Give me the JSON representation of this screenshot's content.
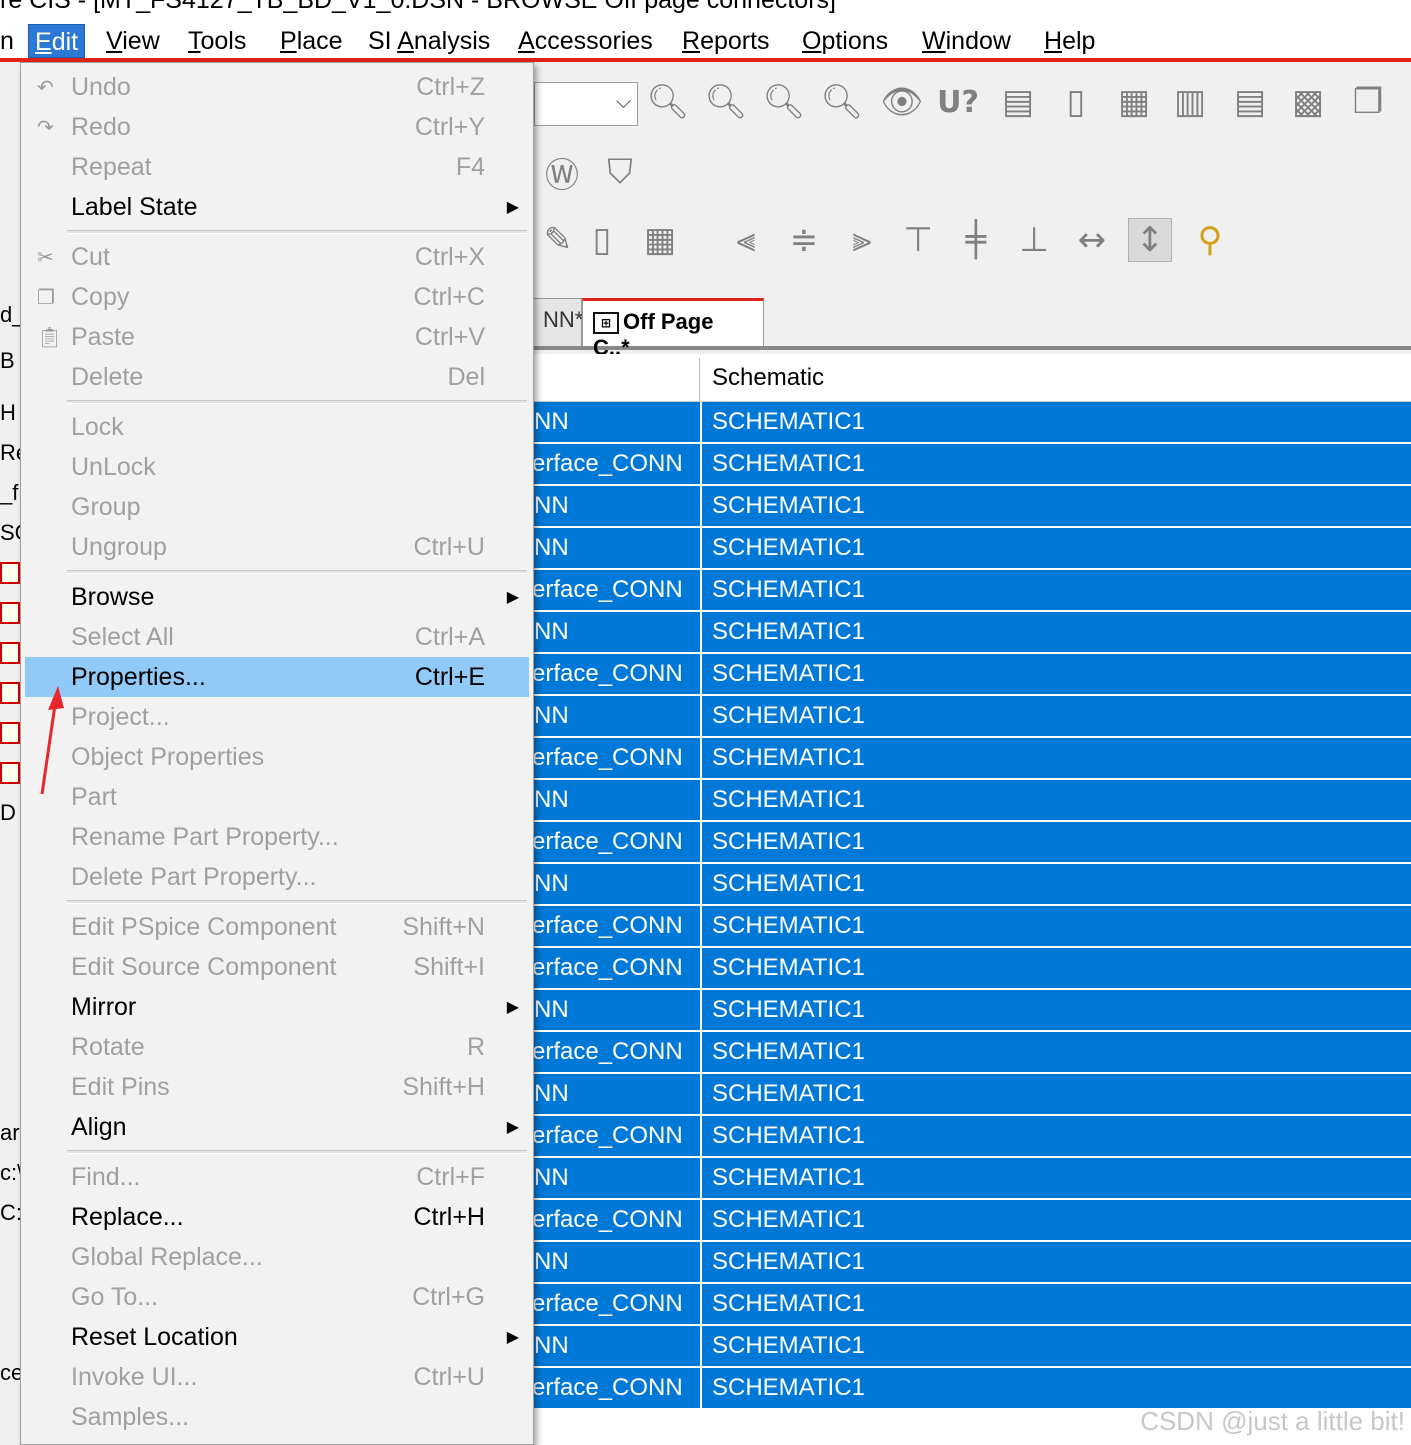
{
  "window": {
    "title": "re CIS - [MT_FS4127_TB_BD_V1_0.DSN - BROWSE Off page connectors]"
  },
  "menubar": {
    "items": [
      {
        "label": "n",
        "id": "file-fragment"
      },
      {
        "label": "Edit",
        "u": "E",
        "active": true
      },
      {
        "label": "View",
        "u": "V"
      },
      {
        "label": "Tools",
        "u": "T"
      },
      {
        "label": "Place",
        "u": "P"
      },
      {
        "label": "SI Analysis",
        "u": "A"
      },
      {
        "label": "Accessories",
        "u": "A"
      },
      {
        "label": "Reports",
        "u": "R"
      },
      {
        "label": "Options",
        "u": "O"
      },
      {
        "label": "Window",
        "u": "W"
      },
      {
        "label": "Help",
        "u": "H"
      }
    ]
  },
  "toolbar": {
    "row1_icons": [
      "zoom-in-icon",
      "zoom-out-icon",
      "zoom-area-icon",
      "zoom-all-icon",
      "eye-icon",
      "u-icon",
      "export-icon",
      "page-icon",
      "netlist-icon",
      "bom-icon",
      "report-icon",
      "grid-icon",
      "copy-page-icon"
    ],
    "row3_icons": [
      "align-left-icon",
      "align-center-icon",
      "align-right-icon",
      "align-top-icon",
      "align-middle-icon",
      "align-bottom-icon",
      "distribute-horizontal-icon",
      "distribute-vertical-icon",
      "tag-icon"
    ]
  },
  "tabs": {
    "inactive_label": "NN*",
    "active_label": "Off Page C..*"
  },
  "grid": {
    "header_schematic": "Schematic",
    "rows": [
      {
        "name": "NN",
        "schematic": "SCHEMATIC1"
      },
      {
        "name": "erface_CONN",
        "schematic": "SCHEMATIC1"
      },
      {
        "name": "NN",
        "schematic": "SCHEMATIC1"
      },
      {
        "name": "NN",
        "schematic": "SCHEMATIC1"
      },
      {
        "name": "erface_CONN",
        "schematic": "SCHEMATIC1"
      },
      {
        "name": "NN",
        "schematic": "SCHEMATIC1"
      },
      {
        "name": "erface_CONN",
        "schematic": "SCHEMATIC1"
      },
      {
        "name": "NN",
        "schematic": "SCHEMATIC1"
      },
      {
        "name": "erface_CONN",
        "schematic": "SCHEMATIC1"
      },
      {
        "name": "NN",
        "schematic": "SCHEMATIC1"
      },
      {
        "name": "erface_CONN",
        "schematic": "SCHEMATIC1"
      },
      {
        "name": "NN",
        "schematic": "SCHEMATIC1"
      },
      {
        "name": "erface_CONN",
        "schematic": "SCHEMATIC1"
      },
      {
        "name": "erface_CONN",
        "schematic": "SCHEMATIC1"
      },
      {
        "name": "NN",
        "schematic": "SCHEMATIC1"
      },
      {
        "name": "erface_CONN",
        "schematic": "SCHEMATIC1"
      },
      {
        "name": "NN",
        "schematic": "SCHEMATIC1"
      },
      {
        "name": "erface_CONN",
        "schematic": "SCHEMATIC1"
      },
      {
        "name": "NN",
        "schematic": "SCHEMATIC1"
      },
      {
        "name": "erface_CONN",
        "schematic": "SCHEMATIC1"
      },
      {
        "name": "NN",
        "schematic": "SCHEMATIC1"
      },
      {
        "name": "erface_CONN",
        "schematic": "SCHEMATIC1"
      },
      {
        "name": "NN",
        "schematic": "SCHEMATIC1"
      },
      {
        "name": "erface_CONN",
        "schematic": "SCHEMATIC1"
      }
    ]
  },
  "left_fragments": [
    "d_",
    "B",
    "H",
    "Re",
    "_f",
    "SC",
    "D",
    "ar",
    "c:\\",
    "C:",
    "ce"
  ],
  "edit_menu": {
    "items": [
      {
        "type": "item",
        "label": "Undo",
        "shortcut": "Ctrl+Z",
        "enabled": false,
        "icon": "undo-icon"
      },
      {
        "type": "item",
        "label": "Redo",
        "shortcut": "Ctrl+Y",
        "enabled": false,
        "icon": "redo-icon"
      },
      {
        "type": "item",
        "label": "Repeat",
        "shortcut": "F4",
        "enabled": false
      },
      {
        "type": "item",
        "label": "Label State",
        "submenu": true,
        "enabled": true
      },
      {
        "type": "sep"
      },
      {
        "type": "item",
        "label": "Cut",
        "shortcut": "Ctrl+X",
        "enabled": false,
        "icon": "scissors-icon"
      },
      {
        "type": "item",
        "label": "Copy",
        "shortcut": "Ctrl+C",
        "enabled": false,
        "icon": "copy-icon"
      },
      {
        "type": "item",
        "label": "Paste",
        "shortcut": "Ctrl+V",
        "enabled": false,
        "icon": "paste-icon"
      },
      {
        "type": "item",
        "label": "Delete",
        "shortcut": "Del",
        "enabled": false
      },
      {
        "type": "sep"
      },
      {
        "type": "item",
        "label": "Lock",
        "enabled": false
      },
      {
        "type": "item",
        "label": "UnLock",
        "enabled": false
      },
      {
        "type": "item",
        "label": "Group",
        "enabled": false
      },
      {
        "type": "item",
        "label": "Ungroup",
        "shortcut": "Ctrl+U",
        "enabled": false
      },
      {
        "type": "sep"
      },
      {
        "type": "item",
        "label": "Browse",
        "submenu": true,
        "enabled": true
      },
      {
        "type": "item",
        "label": "Select All",
        "shortcut": "Ctrl+A",
        "enabled": false
      },
      {
        "type": "item",
        "label": "Properties...",
        "shortcut": "Ctrl+E",
        "enabled": true,
        "highlighted": true
      },
      {
        "type": "item",
        "label": "Project...",
        "enabled": false
      },
      {
        "type": "item",
        "label": "Object Properties",
        "enabled": false
      },
      {
        "type": "item",
        "label": "Part",
        "enabled": false
      },
      {
        "type": "item",
        "label": "Rename Part Property...",
        "enabled": false
      },
      {
        "type": "item",
        "label": "Delete Part Property...",
        "enabled": false
      },
      {
        "type": "sep"
      },
      {
        "type": "item",
        "label": "Edit PSpice Component",
        "shortcut": "Shift+N",
        "enabled": false
      },
      {
        "type": "item",
        "label": "Edit Source Component",
        "shortcut": "Shift+I",
        "enabled": false
      },
      {
        "type": "item",
        "label": "Mirror",
        "submenu": true,
        "enabled": true
      },
      {
        "type": "item",
        "label": "Rotate",
        "shortcut": "R",
        "enabled": false
      },
      {
        "type": "item",
        "label": "Edit Pins",
        "shortcut": "Shift+H",
        "enabled": false
      },
      {
        "type": "item",
        "label": "Align",
        "submenu": true,
        "enabled": true
      },
      {
        "type": "sep"
      },
      {
        "type": "item",
        "label": "Find...",
        "shortcut": "Ctrl+F",
        "enabled": false
      },
      {
        "type": "item",
        "label": "Replace...",
        "shortcut": "Ctrl+H",
        "enabled": true
      },
      {
        "type": "item",
        "label": "Global Replace...",
        "enabled": false
      },
      {
        "type": "item",
        "label": "Go To...",
        "shortcut": "Ctrl+G",
        "enabled": false
      },
      {
        "type": "item",
        "label": "Reset Location",
        "submenu": true,
        "enabled": true
      },
      {
        "type": "item",
        "label": "Invoke UI...",
        "shortcut": "Ctrl+U",
        "enabled": false
      },
      {
        "type": "item",
        "label": "Samples...",
        "enabled": false
      }
    ]
  },
  "watermark": "CSDN @just a little bit!",
  "colors": {
    "selection": "#0078d7",
    "menu_highlight": "#91c9f7",
    "menubar_active": "#2b79d4",
    "accent_red": "#e2231a",
    "annotation_arrow": "#e8262b"
  }
}
